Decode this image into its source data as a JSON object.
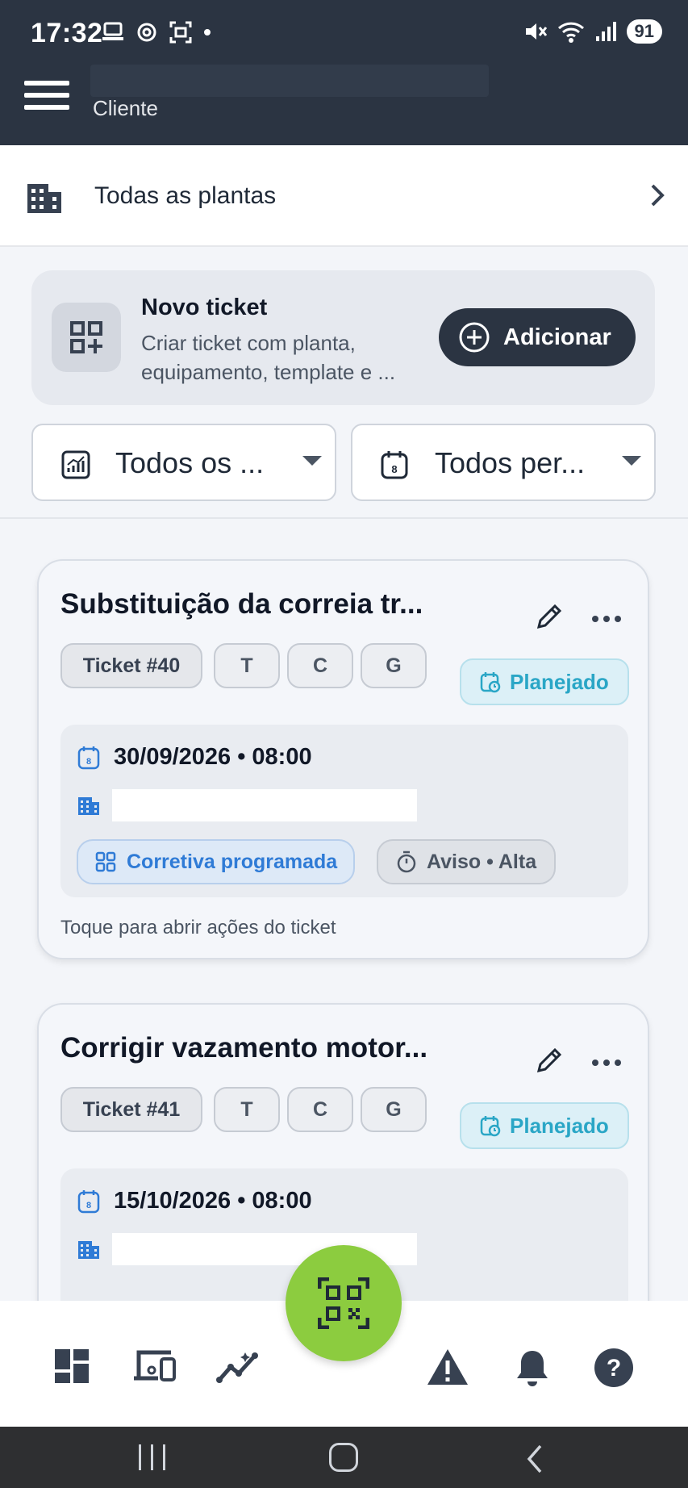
{
  "status_bar": {
    "time": "17:32",
    "battery": "91"
  },
  "app_bar": {
    "subtitle": "Cliente"
  },
  "plant_selector": {
    "label": "Todas as plantas"
  },
  "new_ticket": {
    "title": "Novo ticket",
    "description": "Criar ticket com planta, equipamento, template e ...",
    "add_label": "Adicionar"
  },
  "filters": {
    "status_label": "Todos os ...",
    "period_label": "Todos per..."
  },
  "tickets": [
    {
      "title": "Substituição da correia tr...",
      "id": "Ticket #40",
      "chips": [
        "T",
        "C",
        "G"
      ],
      "status": "Planejado",
      "datetime": "30/09/2026 • 08:00",
      "type": "Corretiva programada",
      "priority": "Aviso • Alta",
      "hint": "Toque para abrir ações do ticket"
    },
    {
      "title": "Corrigir vazamento motor...",
      "id": "Ticket #41",
      "chips": [
        "T",
        "C",
        "G"
      ],
      "status": "Planejado",
      "datetime": "15/10/2026 • 08:00"
    }
  ],
  "colors": {
    "header": "#2b3442",
    "fab": "#8ccc3f",
    "status_planned": "#2aa6c6",
    "type_tag": "#2f7bd6"
  }
}
